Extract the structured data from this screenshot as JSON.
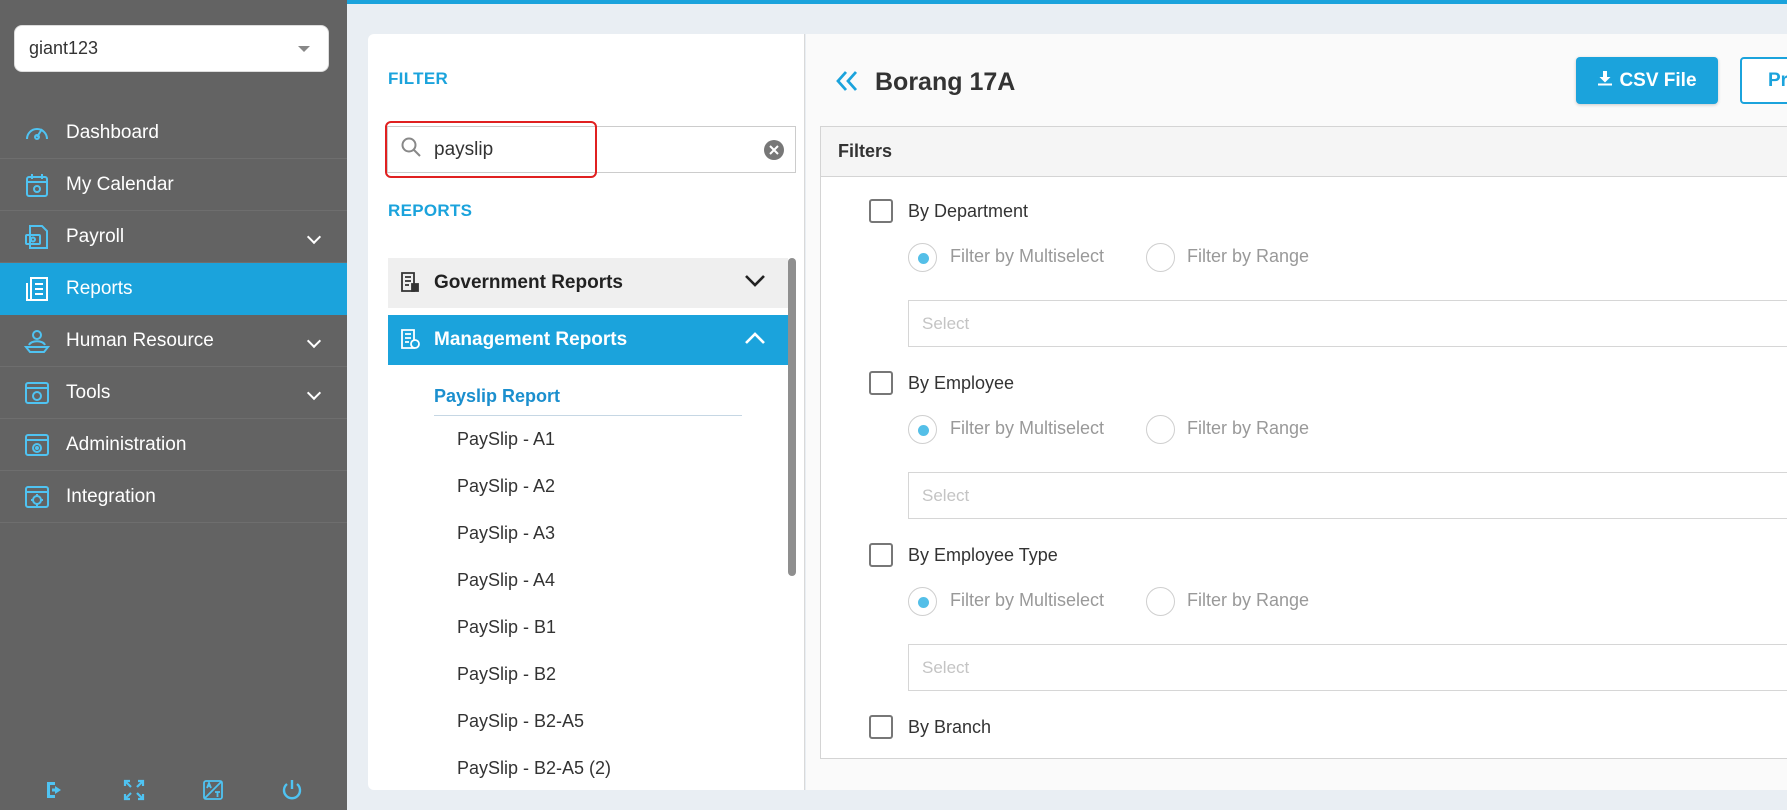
{
  "sidebar": {
    "company": "giant123",
    "items": [
      {
        "label": "Dashboard",
        "icon": "dashboard-icon",
        "has_submenu": false,
        "active": false
      },
      {
        "label": "My Calendar",
        "icon": "calendar-icon",
        "has_submenu": false,
        "active": false
      },
      {
        "label": "Payroll",
        "icon": "payroll-icon",
        "has_submenu": true,
        "active": false
      },
      {
        "label": "Reports",
        "icon": "reports-icon",
        "has_submenu": false,
        "active": true
      },
      {
        "label": "Human Resource",
        "icon": "human-resource-icon",
        "has_submenu": true,
        "active": false
      },
      {
        "label": "Tools",
        "icon": "tools-icon",
        "has_submenu": true,
        "active": false
      },
      {
        "label": "Administration",
        "icon": "administration-icon",
        "has_submenu": false,
        "active": false
      },
      {
        "label": "Integration",
        "icon": "integration-icon",
        "has_submenu": false,
        "active": false
      }
    ],
    "bottom_icons": [
      "logout-icon",
      "fullscreen-icon",
      "language-icon",
      "power-icon"
    ]
  },
  "filter_panel": {
    "filter_title": "FILTER",
    "search_value": "payslip",
    "reports_title": "REPORTS",
    "categories": [
      {
        "label": "Government Reports",
        "expanded": false
      },
      {
        "label": "Management Reports",
        "expanded": true
      }
    ],
    "subcategory": "Payslip Report",
    "reports": [
      "PaySlip - A1",
      "PaySlip - A2",
      "PaySlip - A3",
      "PaySlip - A4",
      "PaySlip - B1",
      "PaySlip - B2",
      "PaySlip - B2-A5",
      "PaySlip - B2-A5 (2)"
    ]
  },
  "main": {
    "title": "Borang 17A",
    "csv_button": "CSV File",
    "preview_button": "Pr",
    "filters_header": "Filters",
    "filters": [
      {
        "label": "By Department",
        "radio1": "Filter by Multiselect",
        "radio2": "Filter by Range",
        "select_placeholder": "Select"
      },
      {
        "label": "By Employee",
        "radio1": "Filter by Multiselect",
        "radio2": "Filter by Range",
        "select_placeholder": "Select"
      },
      {
        "label": "By Employee Type",
        "radio1": "Filter by Multiselect",
        "radio2": "Filter by Range",
        "select_placeholder": "Select"
      },
      {
        "label": "By Branch"
      }
    ]
  },
  "colors": {
    "accent": "#1ba3dc",
    "sidebar_bg": "#636363",
    "highlight": "#e02020"
  }
}
